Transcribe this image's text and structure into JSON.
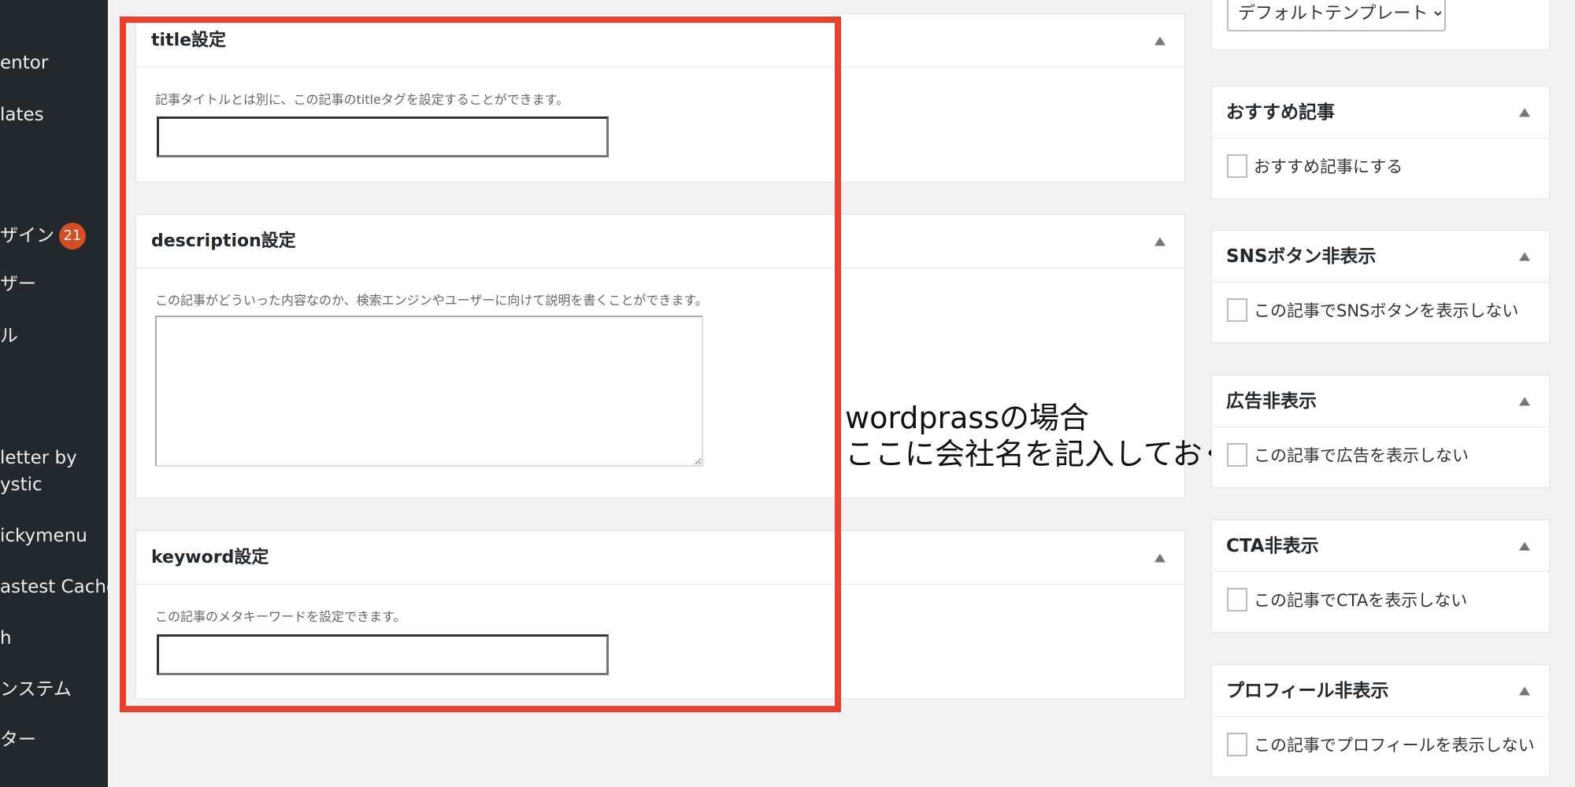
{
  "sidebar": {
    "items": [
      {
        "label": "entor"
      },
      {
        "label": "lates"
      },
      {
        "label": "ザイン",
        "badge": "21"
      },
      {
        "label": "ザー"
      },
      {
        "label": "ル"
      },
      {
        "label": "letter by"
      },
      {
        "label": "ystic"
      },
      {
        "label": "ickymenu"
      },
      {
        "label": "astest Cache"
      },
      {
        "label": "h"
      },
      {
        "label": "ンステム"
      },
      {
        "label": "ター"
      }
    ]
  },
  "main": {
    "title_box": {
      "heading": "title設定",
      "description": "記事タイトルとは別に、この記事のtitleタグを設定することができます。",
      "value": ""
    },
    "description_box": {
      "heading": "description設定",
      "description": "この記事がどういった内容なのか、検索エンジンやユーザーに向けて説明を書くことができます。",
      "value": ""
    },
    "keyword_box": {
      "heading": "keyword設定",
      "description": "この記事のメタキーワードを設定できます。",
      "value": ""
    }
  },
  "annotation": {
    "line1": "wordprassの場合",
    "line2": "ここに会社名を記入しておく"
  },
  "right_sidebar": {
    "template_select": "デフォルトテンプレート",
    "boxes": [
      {
        "title": "おすすめ記事",
        "option": "おすすめ記事にする"
      },
      {
        "title": "SNSボタン非表示",
        "option": "この記事でSNSボタンを表示しない"
      },
      {
        "title": "広告非表示",
        "option": "この記事で広告を表示しない"
      },
      {
        "title": "CTA非表示",
        "option": "この記事でCTAを表示しない"
      },
      {
        "title": "プロフィール非表示",
        "option": "この記事でプロフィールを表示しない"
      }
    ]
  },
  "colors": {
    "highlight": "#e8412c",
    "sidebar_bg": "#23282d",
    "badge": "#d54e21"
  }
}
